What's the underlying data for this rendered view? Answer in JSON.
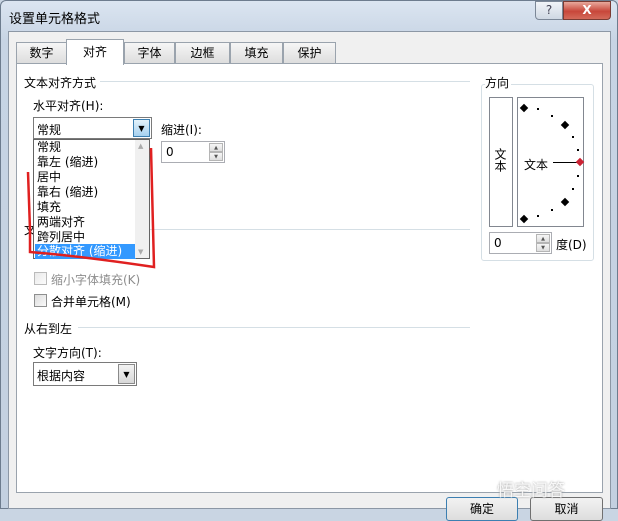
{
  "window": {
    "title": "设置单元格格式",
    "help_label": "?",
    "close_label": "X"
  },
  "tabs": [
    {
      "label": "数字"
    },
    {
      "label": "对齐",
      "selected": true
    },
    {
      "label": "字体"
    },
    {
      "label": "边框"
    },
    {
      "label": "填充"
    },
    {
      "label": "保护"
    }
  ],
  "alignment": {
    "section_title": "文本对齐方式",
    "horizontal_label": "水平对齐(H):",
    "horizontal_value": "常规",
    "horizontal_options": [
      "常规",
      "靠左 (缩进)",
      "居中",
      "靠右 (缩进)",
      "填充",
      "两端对齐",
      "跨列居中",
      "分散对齐 (缩进)"
    ],
    "highlighted_option": "分散对齐 (缩进)",
    "indent_label": "缩进(I):",
    "indent_value": "0"
  },
  "text_control": {
    "section_title": "文本控制",
    "shrink_label": "缩小字体填充(K)",
    "merge_label": "合并单元格(M)"
  },
  "rtl": {
    "section_title": "从右到左",
    "direction_label": "文字方向(T):",
    "direction_value": "根据内容"
  },
  "orientation": {
    "section_title": "方向",
    "vertical_text": "文本",
    "dial_text": "文本",
    "degrees_value": "0",
    "degrees_label": "度(D)"
  },
  "buttons": {
    "ok": "确定",
    "cancel": "取消"
  },
  "watermark": "悟空问答",
  "colors": {
    "selection": "#3399ff",
    "annotation": "#e02020",
    "dial_marker": "#cc2233"
  }
}
